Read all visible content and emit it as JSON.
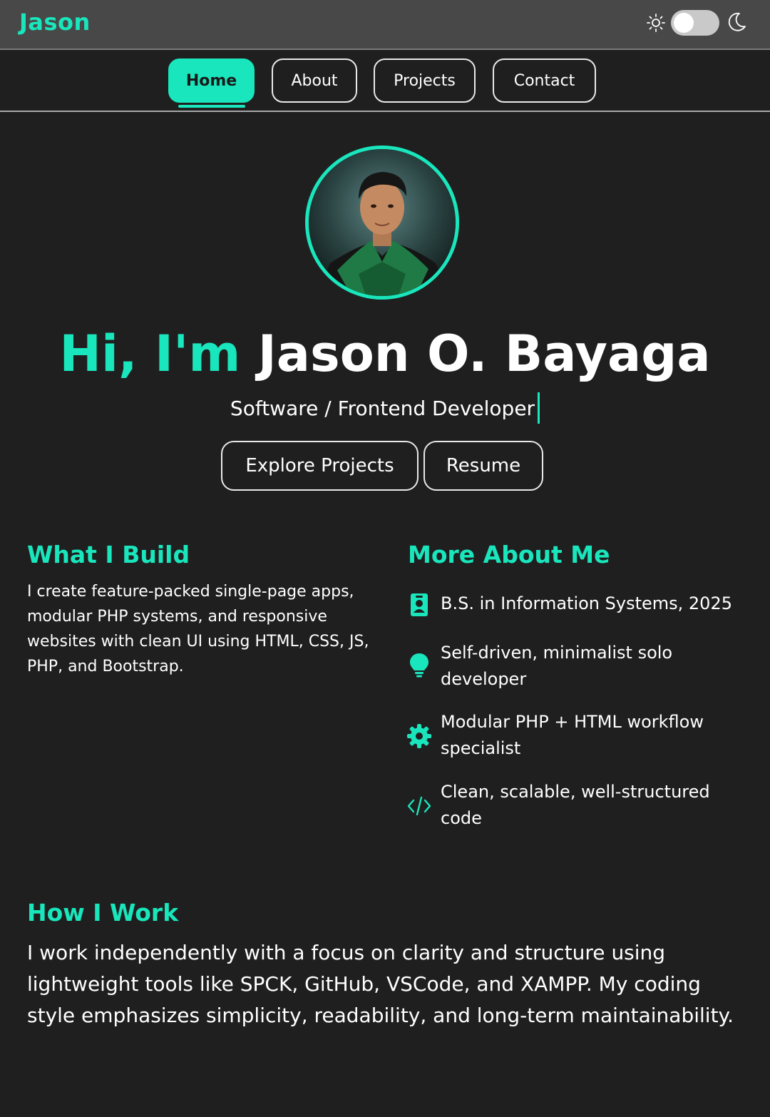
{
  "header": {
    "brand": "Jason",
    "theme": {
      "mode": "dark",
      "light_icon": "sun-icon",
      "dark_icon": "moon-icon"
    }
  },
  "nav": {
    "items": [
      {
        "label": "Home",
        "active": true
      },
      {
        "label": "About",
        "active": false
      },
      {
        "label": "Projects",
        "active": false
      },
      {
        "label": "Contact",
        "active": false
      }
    ]
  },
  "hero": {
    "greeting": "Hi, I'm",
    "name": "Jason O. Bayaga",
    "subtitle": "Software / Frontend Developer",
    "buttons": {
      "explore": "Explore Projects",
      "resume": "Resume"
    }
  },
  "build": {
    "heading": "What I Build",
    "text": "I create feature-packed single-page apps, modular PHP systems, and responsive websites with clean UI using HTML, CSS, JS, PHP, and Bootstrap."
  },
  "about": {
    "heading": "More About Me",
    "items": [
      {
        "icon": "id-badge-icon",
        "text": "B.S. in Information Systems, 2025"
      },
      {
        "icon": "lightbulb-icon",
        "text": "Self-driven, minimalist solo developer"
      },
      {
        "icon": "gear-icon",
        "text": "Modular PHP + HTML workflow specialist"
      },
      {
        "icon": "code-icon",
        "text": "Clean, scalable, well-structured code"
      }
    ]
  },
  "work": {
    "heading": "How I Work",
    "text": "I work independently with a focus on clarity and structure using lightweight tools like SPCK, GitHub, VSCode, and XAMPP. My coding style emphasizes simplicity, readability, and long-term maintainability."
  },
  "colors": {
    "accent": "#19e6bc",
    "background": "#1f1f1f",
    "header": "#484848"
  }
}
